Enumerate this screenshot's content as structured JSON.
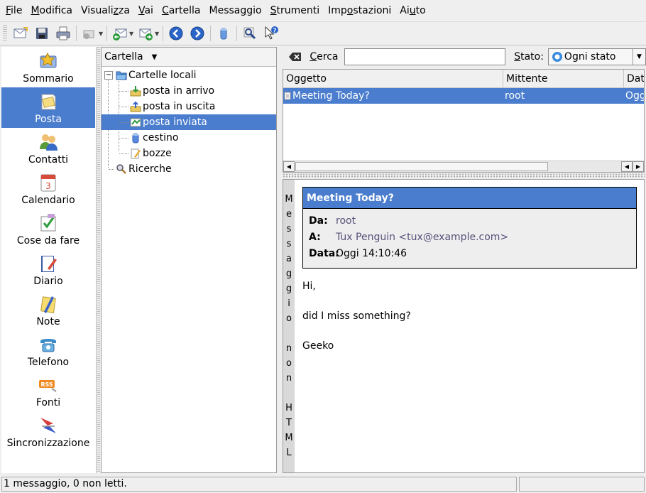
{
  "menubar": {
    "items": [
      {
        "pre": "",
        "ul": "F",
        "post": "ile"
      },
      {
        "pre": "",
        "ul": "M",
        "post": "odifica"
      },
      {
        "pre": "Visuali",
        "ul": "z",
        "post": "za"
      },
      {
        "pre": "",
        "ul": "V",
        "post": "ai"
      },
      {
        "pre": "",
        "ul": "C",
        "post": "artella"
      },
      {
        "pre": "Messa",
        "ul": "g",
        "post": "gio"
      },
      {
        "pre": "",
        "ul": "S",
        "post": "trumenti"
      },
      {
        "pre": "Imp",
        "ul": "o",
        "post": "stazioni"
      },
      {
        "pre": "Ai",
        "ul": "u",
        "post": "to"
      }
    ]
  },
  "sidebar": {
    "items": [
      {
        "label": "Sommario",
        "icon": "summary-icon"
      },
      {
        "label": "Posta",
        "icon": "mail-icon"
      },
      {
        "label": "Contatti",
        "icon": "contacts-icon"
      },
      {
        "label": "Calendario",
        "icon": "calendar-icon"
      },
      {
        "label": "Cose da fare",
        "icon": "todo-icon"
      },
      {
        "label": "Diario",
        "icon": "journal-icon"
      },
      {
        "label": "Note",
        "icon": "notes-icon"
      },
      {
        "label": "Telefono",
        "icon": "phone-icon"
      },
      {
        "label": "Fonti",
        "icon": "rss-icon"
      },
      {
        "label": "Sincronizzazione",
        "icon": "sync-icon"
      }
    ],
    "selected": "Posta"
  },
  "folders": {
    "header": "Cartella",
    "local_folders": "Cartelle locali",
    "items": [
      {
        "label": "posta in arrivo",
        "icon": "inbox-icon"
      },
      {
        "label": "posta in uscita",
        "icon": "outbox-icon"
      },
      {
        "label": "posta inviata",
        "icon": "sent-icon"
      },
      {
        "label": "cestino",
        "icon": "trash-icon"
      },
      {
        "label": "bozze",
        "icon": "drafts-icon"
      }
    ],
    "searches": "Ricerche",
    "selected": "posta inviata"
  },
  "search": {
    "label_pre": "",
    "label_ul": "C",
    "label_post": "erca",
    "value": "",
    "state_label_pre": "",
    "state_label_ul": "S",
    "state_label_post": "tato:",
    "state_value": "Ogni stato"
  },
  "message_list": {
    "columns": [
      "Oggetto",
      "Mittente",
      "Dat"
    ],
    "rows": [
      {
        "subject": "Meeting Today?",
        "sender": "root",
        "date": "Ogg"
      }
    ]
  },
  "preview": {
    "vertical_label": [
      "M",
      "e",
      "s",
      "s",
      "a",
      "g",
      "g",
      "i",
      "o",
      "",
      "n",
      "o",
      "n",
      "",
      "H",
      "T",
      "M",
      "L"
    ],
    "title": "Meeting Today?",
    "from_key": "Da:",
    "from": "root",
    "to_key": "A:",
    "to": "Tux Penguin <tux@example.com>",
    "date_key": "Data:",
    "date": "Oggi 14:10:46",
    "body": [
      "Hi,",
      "did I miss something?",
      "Geeko"
    ]
  },
  "statusbar": {
    "text": "1 messaggio, 0 non letti."
  },
  "colors": {
    "selection": "#4a7dcd",
    "background": "#eeeeee"
  }
}
